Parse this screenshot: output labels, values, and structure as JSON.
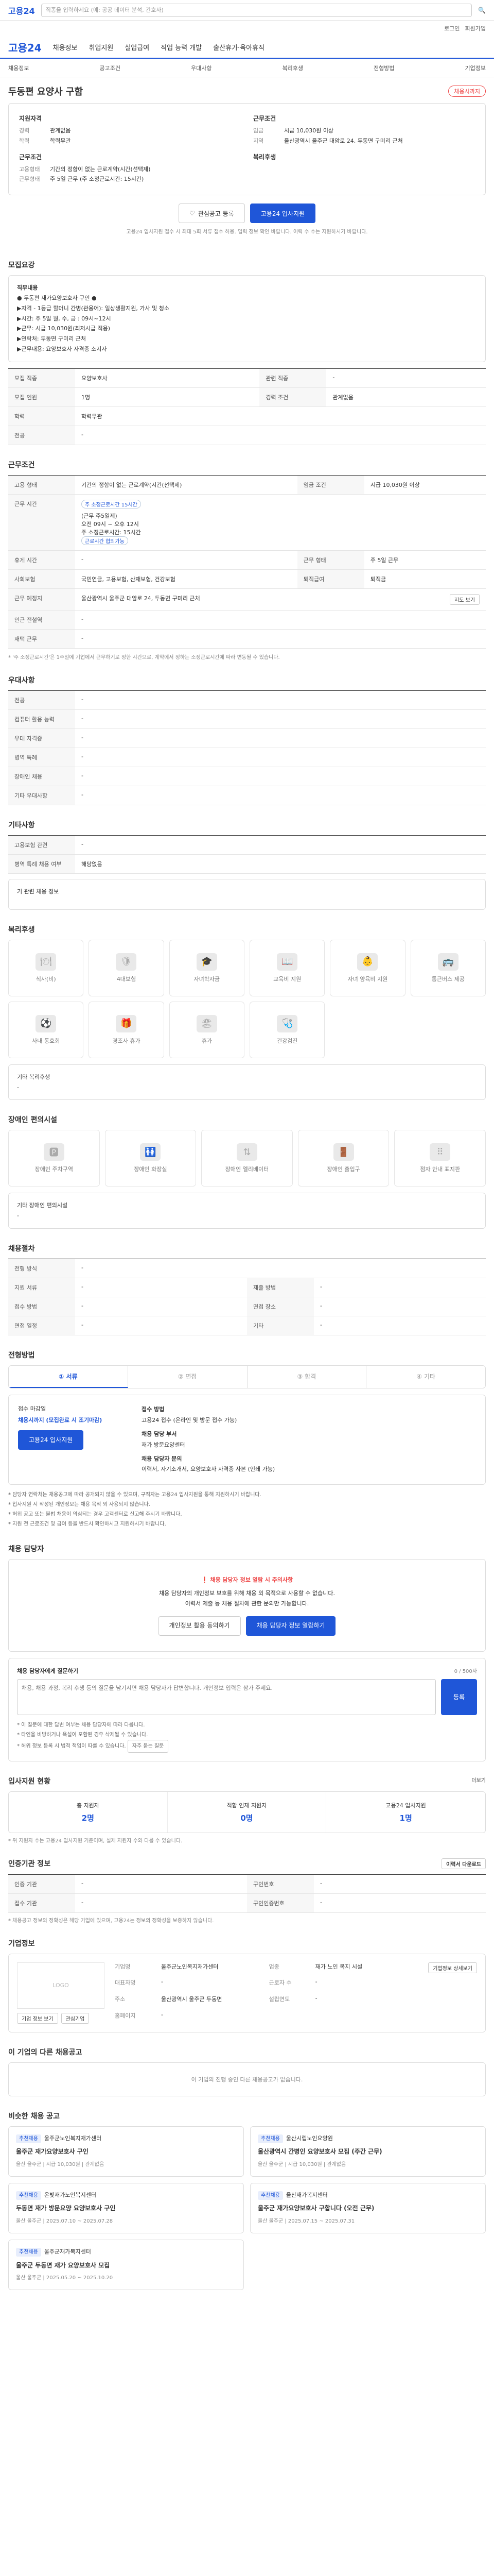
{
  "gnb": {
    "logo": "고용24",
    "search_placeholder": "직종을 입력하세요 (예: 공공 데이터 분석, 간호사)"
  },
  "util": [
    "로그인",
    "회원가입"
  ],
  "header": {
    "brand": "고용24",
    "menus": [
      "채용정보",
      "취업지원",
      "실업급여",
      "직업 능력 개발",
      "출산휴가·육아휴직"
    ]
  },
  "subnav": [
    "채용정보",
    "공고조건",
    "우대사항",
    "복리후생",
    "전형방법",
    "기업정보"
  ],
  "title": "두동편 요양사 구함",
  "title_badge": "채용시까지",
  "summary": {
    "left_title": "지원자격",
    "left": [
      [
        "경력",
        "관계없음"
      ],
      [
        "학력",
        "학력무관"
      ]
    ],
    "left2_title": "근무조건",
    "left2": [
      [
        "고용형태",
        "기간의 정함이 없는 근로계약(시간(선택제)"
      ],
      [
        "근무형태",
        "주 5일 근무 (주 소정근로시간: 15시간)"
      ]
    ],
    "right_title": "근무조건",
    "right": [
      [
        "임금",
        "시급 10,030원 이상"
      ],
      [
        "지역",
        "울산광역시 울주군 대암로 24, 두동면 구미리 근처"
      ]
    ],
    "right2_title": "복리후생",
    "right2": []
  },
  "actions": {
    "favorite": "관심공고 등록",
    "apply": "고용24 입사지원"
  },
  "notice_text": "고용24 입사지원 접수 시 최대 5회 서류 접수 허용. 입력 정보 확인 바랍니다. 이력 수 수는 지원하시기 바랍니다.",
  "recruit_title": "모집요강",
  "recruit_box": [
    "직무내용",
    "● 두동편 재가요양보호사 구인 ●",
    "",
    "▶자격 - 1등급 할머니 간병(관용어): 일상생활지원, 가사 및 청소",
    "▶시간: 주 5일 월, 수, 금 : 09시~12시",
    "▶근무: 시급 10,030원(최저시급 적용)",
    "▶연락처: 두동면 구미리 근처",
    "▶근무내용: 요양보호사 자격증 소지자"
  ],
  "recruit_rows": [
    [
      "모집 직종",
      "요양보호사",
      "관련 직종",
      "-"
    ],
    [
      "모집 인원",
      "1명",
      "경력 조건",
      "관계없음"
    ],
    [
      "학력",
      "학력무관",
      "",
      ""
    ],
    [
      "전공",
      "-",
      "",
      ""
    ]
  ],
  "work_title": "근무조건",
  "work_rows": {
    "employment": "기간의 정함이 없는 근로계약(시간(선택제)",
    "wage_label": "임금 조건",
    "wage": "시급 10,030원 이상",
    "wage_chip": "주 소정근로시간 15시간",
    "hours_title": "근무 시간",
    "hours": [
      "(근무 주5일제)",
      "오전 09시 ~ 오후 12시",
      "주 소정근로시간: 15시간",
      "근로시간 협의가능"
    ],
    "meal": "-",
    "type": "주 5일 근무",
    "social": "국민연금, 고용보험, 산재보험, 건강보험",
    "retire": "퇴직금",
    "address": "울산광역시 울주군 대암로 24, 두동면 구미리 근처",
    "map_btn": "지도 보기",
    "nearby": "-",
    "rest": "-"
  },
  "work_note": "* '주 소정근로시간'은 1주일에 기업에서 근무하기로 정한 시간으로, 계약에서 정하는 소정근로시간에 따라 변동될 수 있습니다.",
  "prefer_title": "우대사항",
  "prefer_rows": [
    [
      "전공",
      "-"
    ],
    [
      "컴퓨터 활용 능력",
      "-"
    ],
    [
      "우대 자격증",
      "-"
    ],
    [
      "병역 특례",
      "-"
    ],
    [
      "장애인 채용",
      "-"
    ],
    [
      "기타 우대사항",
      "-"
    ]
  ],
  "prefer2_title": "기타사항",
  "prefer2_rows": [
    [
      "고용보험 관련",
      "-"
    ],
    [
      "병역 특례 채용 여부",
      "해당없음"
    ]
  ],
  "prefer2_more": "기 관련 채용 정보",
  "welfare_title": "복리후생",
  "welfare": [
    "식사(비)",
    "4대보험",
    "자녀학자금",
    "교육비 지원",
    "자녀 양육비 지원",
    "통근버스 제공",
    "사내 동호회",
    "경조사 휴가",
    "휴가",
    "건강검진"
  ],
  "welfare_extra_title": "기타 복리후생",
  "welfare_extra": "-",
  "disabled_title": "장애인 편의시설",
  "disabled": [
    "장애인 주차구역",
    "장애인 화장실",
    "장애인 엘리베이터",
    "장애인 출입구",
    "점자 안내 표지판"
  ],
  "disabled_extra_title": "기타 장애인 편의시설",
  "disabled_extra": "-",
  "process_title": "채용절차",
  "process_rows": [
    [
      "전형 방식",
      "-"
    ],
    [
      "지원 서류",
      "-",
      "제출 방법",
      "-"
    ],
    [
      "접수 방법",
      "-",
      "면접 장소",
      "-"
    ],
    [
      "면접 일정",
      "-",
      "기타",
      "-"
    ]
  ],
  "apply_title": "전형방법",
  "steps": [
    "① 서류",
    "② 면접",
    "③ 합격",
    "④ 기타"
  ],
  "apply": {
    "how_label": "접수 마감일",
    "deadline": "채용시까지 (모집완료 시 조기마감)",
    "btn": "고용24 입사지원",
    "method_label": "접수 방법",
    "method": "고용24 접수 (온라인 및 방문 접수 가능)",
    "dept_label": "채용 담당 부서",
    "dept": "재가 방문요양센터",
    "contact_label": "채용 담당자 문의",
    "contact": "이력서, 자기소개서, 요양보호사 자격증 사본 (인쇄 가능)"
  },
  "apply_notes": [
    "* 담당자 연락처는 채용공고에 따라 공개되지 않을 수 있으며, 구직자는 고용24 입사지원을 통해 지원하시기 바랍니다.",
    "* 입사지원 시 작성된 개인정보는 채용 목적 외 사용되지 않습니다.",
    "* 허위 공고 또는 불법 채용이 의심되는 경우 고객센터로 신고해 주시기 바랍니다.",
    "* 지원 전 근로조건 및 급여 등을 반드시 확인하시고 지원하시기 바랍니다."
  ],
  "qa_title": "채용 담당자",
  "qa": {
    "warn": "❗ 채용 담당자 정보 열람 시 주의사항",
    "text1": "채용 담당자의 개인정보 보호를 위해 채용 외 목적으로 사용할 수 없습니다.",
    "text2": "이력서 제출 등 채용 절차에 관한 문의만 가능합니다.",
    "btn1": "개인정보 활용 동의하기",
    "btn2": "채용 담당자 정보 열람하기"
  },
  "inquiry": {
    "title": "채용 담당자에게 질문하기",
    "count": "0 / 500자",
    "placeholder": "채용, 채용 과정, 복리 후생 등의 질문을 남기시면 채용 담당자가 답변합니다. 개인정보 입력은 삼가 주세요.",
    "send": "등록",
    "notes": [
      "* 이 질문에 대한 답변 여부는 채용 담당자에 따라 다릅니다.",
      "* 타인을 비방하거나 욕설이 포함된 경우 삭제될 수 있습니다.",
      "* 허위 정보 등록 시 법적 책임이 따를 수 있습니다."
    ],
    "notes_btn": "자주 묻는 질문"
  },
  "stats_title": "입사지원 현황",
  "stats_more": "더보기",
  "stats": [
    [
      "총 지원자",
      "2명"
    ],
    [
      "적합 인재 지원자",
      "0명"
    ],
    [
      "고용24 입사지원",
      "1명"
    ]
  ],
  "stats_note": "* 위 지원자 수는 고용24 입사지원 기준이며, 실제 지원자 수와 다를 수 있습니다.",
  "reg_title": "인증기관 정보",
  "reg_btn": "이력서 다운로드",
  "reg_rows": [
    [
      "인증 기관",
      "-",
      "구인번호",
      "-"
    ],
    [
      "접수 기관",
      "-",
      "구인인증번호",
      "-"
    ]
  ],
  "reg_note": "* 채용공고 정보의 정확성은 해당 기업에 있으며, 고용24는 정보의 정확성을 보증하지 않습니다.",
  "company_title": "기업정보",
  "company": {
    "logo": "LOGO",
    "btn1": "기업 정보 보기",
    "btn2": "관심기업",
    "rows": [
      [
        "기업명",
        "울주군노인복지재가센터",
        "업종",
        "재가 노인 복지 시설"
      ],
      [
        "대표자명",
        "-",
        "근로자 수",
        "-"
      ],
      [
        "주소",
        "울산광역시 울주군 두동면",
        "설립연도",
        "-"
      ],
      [
        "홈페이지",
        "-",
        "",
        ""
      ]
    ],
    "detail_btn": "기업정보 상세보기"
  },
  "other_title": "이 기업의 다른 채용공고",
  "other_empty": "이 기업의 진행 중인 다른 채용공고가 없습니다.",
  "rec_title": "비슷한 채용 공고",
  "rec": [
    {
      "chip": "추천채용",
      "company": "울주군노인복지재가센터",
      "title": "울주군 재가요양보호사 구인",
      "meta": "울산 울주군  |  시급 10,030원  |  관계없음"
    },
    {
      "chip": "추천채용",
      "company": "울산시립노인요양원",
      "title": "울산광역시 간병인 요양보호사 모집 (주간 근무)",
      "meta": "울산 울주군  |  시급 10,030원  |  관계없음"
    },
    {
      "chip": "추천채용",
      "company": "온빛재가노인복지센터",
      "title": "두동면 재가 방문요양 요양보호사 구인",
      "meta": "울산 울주군  |  2025.07.10 ~ 2025.07.28"
    },
    {
      "chip": "추천채용",
      "company": "울산재가복지센터",
      "title": "울주군 재가요양보호사 구합니다 (오전 근무)",
      "meta": "울산 울주군  |  2025.07.15 ~ 2025.07.31"
    },
    {
      "chip": "추천채용",
      "company": "울주군재가복지센터",
      "title": "울주군 두동면 재가 요양보호사 모집",
      "meta": "울산 울주군  |  2025.05.20 ~ 2025.10.20"
    }
  ]
}
